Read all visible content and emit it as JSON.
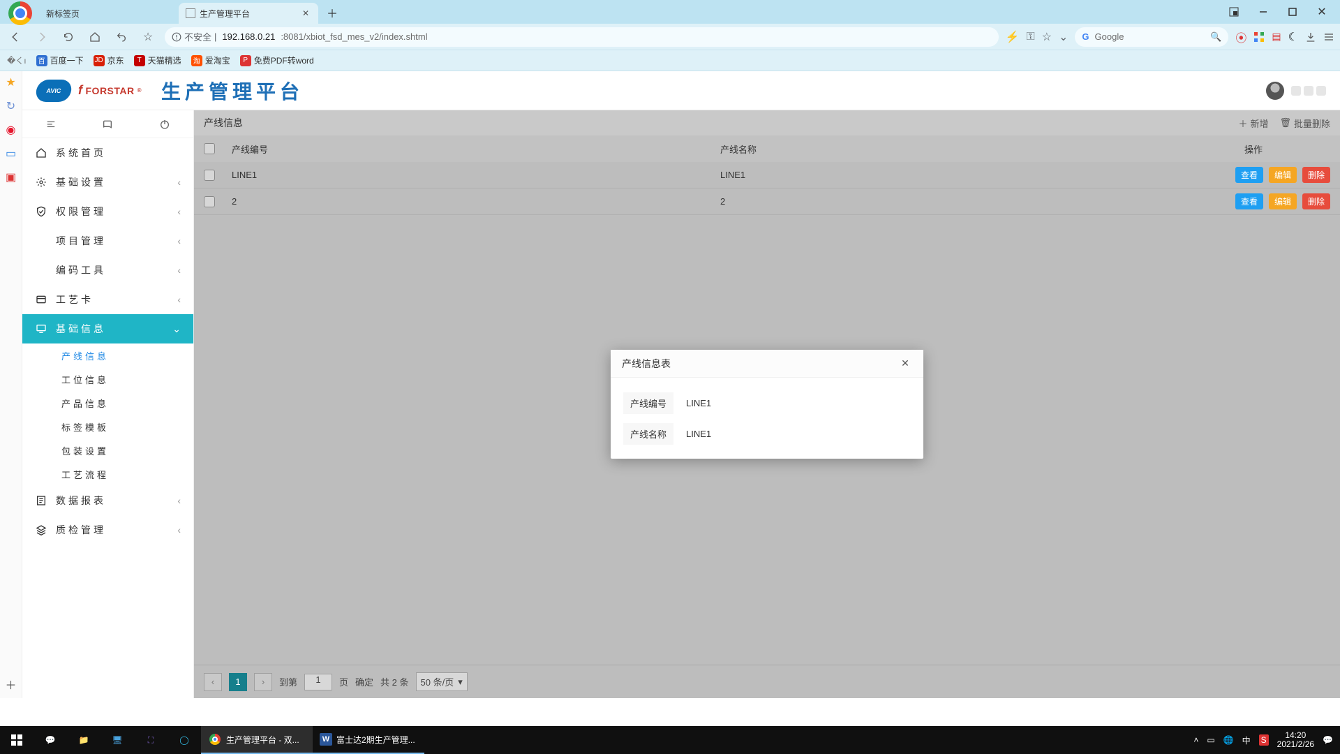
{
  "window": {
    "tabs": [
      {
        "title": "新标签页",
        "active": false
      },
      {
        "title": "生产管理平台",
        "active": true
      }
    ]
  },
  "addressbar": {
    "insecure_label": "不安全",
    "host": "192.168.0.21",
    "port_path": ":8081/xbiot_fsd_mes_v2/index.shtml",
    "search_engine_label": "Google"
  },
  "bookmarks": [
    {
      "label": "百度一下",
      "color": "#2f6fd1"
    },
    {
      "label": "京东",
      "color": "#d81e06"
    },
    {
      "label": "天猫精选",
      "color": "#c40000"
    },
    {
      "label": "爱淘宝",
      "color": "#ff5000"
    },
    {
      "label": "免费PDF转word",
      "color": "#d33"
    }
  ],
  "app": {
    "brand_sub": "FORSTAR",
    "title": "生产管理平台"
  },
  "sidebar": {
    "groups": [
      {
        "icon": "home",
        "label": "系统首页",
        "expandable": false
      },
      {
        "icon": "gear",
        "label": "基础设置",
        "expandable": true
      },
      {
        "icon": "shield",
        "label": "权限管理",
        "expandable": true
      },
      {
        "icon": "blank",
        "label": "项目管理",
        "expandable": true
      },
      {
        "icon": "blank",
        "label": "编码工具",
        "expandable": true
      },
      {
        "icon": "card",
        "label": "工艺卡",
        "expandable": true
      },
      {
        "icon": "monitor",
        "label": "基础信息",
        "expandable": true,
        "expanded": true,
        "children": [
          {
            "label": "产线信息",
            "active": true
          },
          {
            "label": "工位信息"
          },
          {
            "label": "产品信息"
          },
          {
            "label": "标签模板"
          },
          {
            "label": "包装设置"
          },
          {
            "label": "工艺流程"
          }
        ]
      },
      {
        "icon": "report",
        "label": "数据报表",
        "expandable": true
      },
      {
        "icon": "layers",
        "label": "质检管理",
        "expandable": true
      }
    ]
  },
  "panel": {
    "title": "产线信息",
    "actions": {
      "add": "新增",
      "batch_delete": "批量删除"
    },
    "columns": {
      "code": "产线编号",
      "name": "产线名称",
      "ops": "操作"
    },
    "op_labels": {
      "view": "查看",
      "edit": "编辑",
      "del": "删除"
    },
    "rows": [
      {
        "code": "LINE1",
        "name": "LINE1"
      },
      {
        "code": "2",
        "name": "2"
      }
    ]
  },
  "pager": {
    "current": "1",
    "goto_label": "到第",
    "page_suffix": "页",
    "goto_input": "1",
    "confirm": "确定",
    "total": "共 2 条",
    "page_size": "50 条/页"
  },
  "modal": {
    "title": "产线信息表",
    "fields": [
      {
        "label": "产线编号",
        "value": "LINE1"
      },
      {
        "label": "产线名称",
        "value": "LINE1"
      }
    ]
  },
  "taskbar": {
    "apps": [
      {
        "label": "生产管理平台 - 双...",
        "kind": "chrome",
        "active": true
      },
      {
        "label": "富士达2期生产管理...",
        "kind": "word",
        "active": false
      }
    ],
    "time": "14:20",
    "date": "2021/2/26"
  }
}
